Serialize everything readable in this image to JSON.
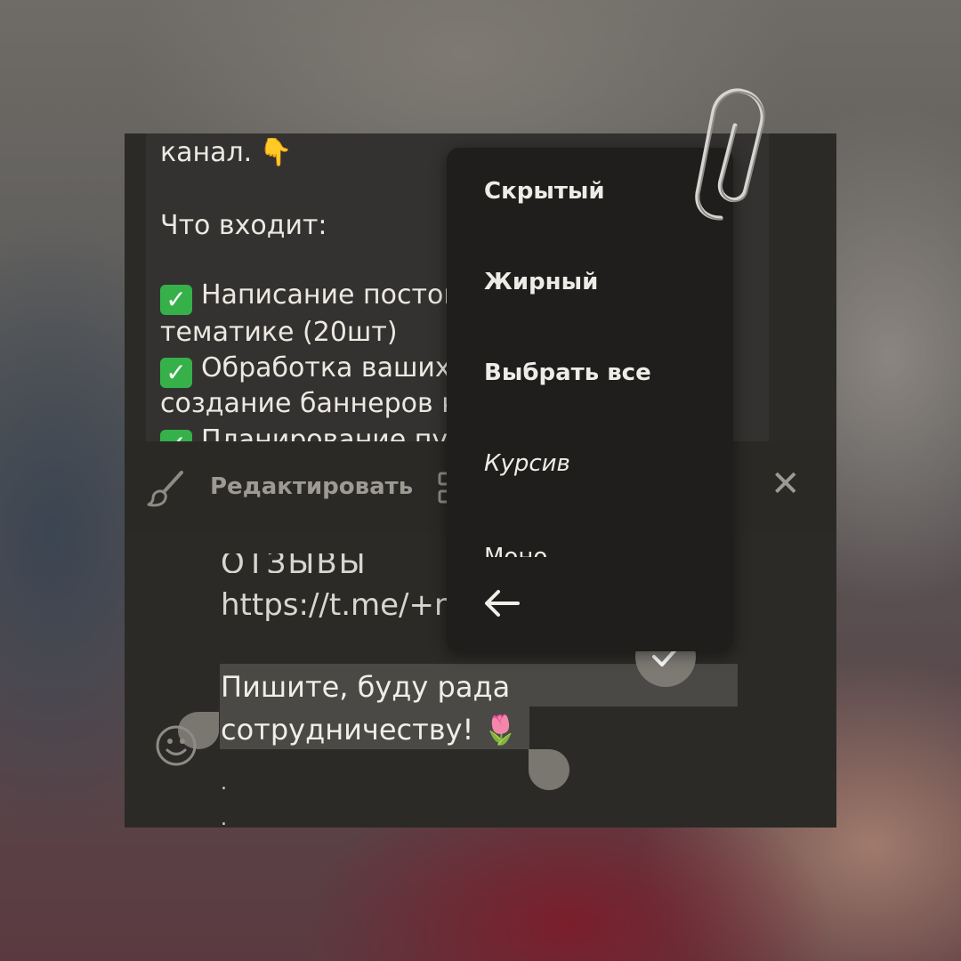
{
  "message": {
    "line_channel": "канал.",
    "line_includes": "Что входит:",
    "item1_a": "Написание постов",
    "item1_b": "тематике (20шт)",
    "item2_a": "Обработка ваших",
    "item2_b": "создание баннеров к",
    "item3_cut": "Планирование пу"
  },
  "editbar": {
    "edit_label": "Редактировать",
    "close_glyph": "✕"
  },
  "input": {
    "reviews_cut": "ОТЗЫВЫ",
    "link": "https://t.me/+r",
    "selected_line1": "Пишите, буду рада",
    "selected_line2": "сотрудничеству!",
    "tulip": "🌷",
    "dot": "."
  },
  "context_menu": {
    "items": [
      "Скрытый",
      "Жирный",
      "Выбрать все",
      "Курсив"
    ],
    "cut_item": "Моно"
  },
  "icons": {
    "brush": "brush-icon",
    "copy": "copy-icon",
    "close": "close-icon",
    "emoji": "smile-icon",
    "send": "check-icon",
    "back": "arrow-left-icon",
    "paperclip": "paperclip-icon"
  },
  "colors": {
    "background_dark": "#2b2a26",
    "selection": "#4a4945",
    "check_green": "#36b14a",
    "menu_bg": "#1f1e1c"
  }
}
